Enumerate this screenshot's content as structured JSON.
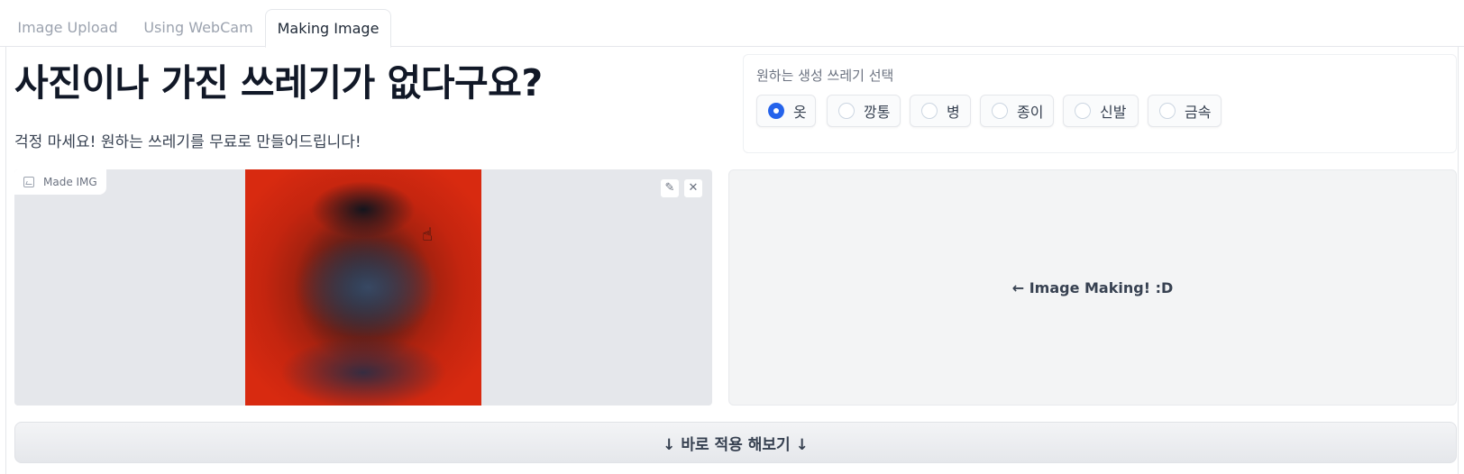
{
  "tabs": [
    {
      "label": "Image Upload"
    },
    {
      "label": "Using WebCam"
    },
    {
      "label": "Making Image"
    }
  ],
  "header": {
    "title": "사진이나 가진 쓰레기가 없다구요?",
    "subtitle": "걱정 마세요! 원하는 쓰레기를 무료로 만들어드립니다!"
  },
  "selector": {
    "label": "원하는 생성 쓰레기 선택",
    "selected": "옷",
    "options": [
      "옷",
      "깡통",
      "병",
      "종이",
      "신발",
      "금속"
    ]
  },
  "image_panel": {
    "badge": "Made IMG",
    "edit_icon": "pencil-icon",
    "close_icon": "close-icon"
  },
  "output_panel": {
    "text": "← Image Making! :D"
  },
  "apply_button": {
    "label": "↓ 바로 적용 해보기 ↓"
  }
}
